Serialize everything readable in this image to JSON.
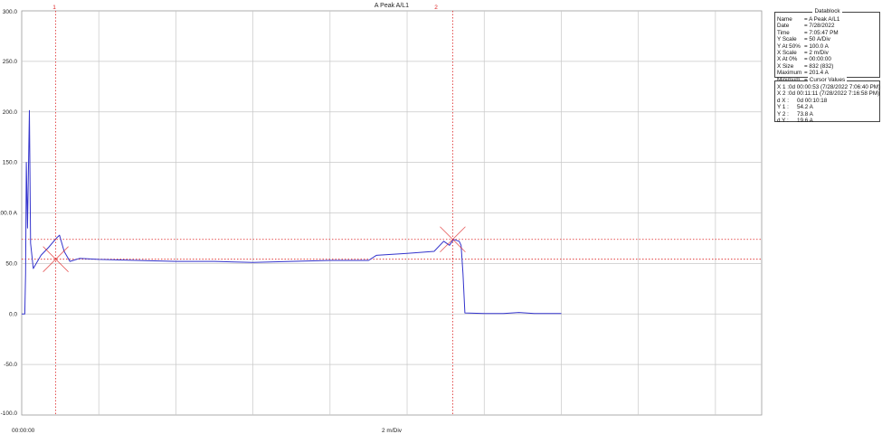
{
  "title": "A Peak A/L1",
  "x_start_label": "00:00:00",
  "x_div_label": "2 m/Div",
  "cursor_markers": {
    "c1": "1",
    "c2": "2"
  },
  "colors": {
    "trace": "#3333cc",
    "cursor": "#dd2222",
    "grid": "#c8c8c8"
  },
  "datablock": {
    "title": "Datablock",
    "rows": [
      {
        "k": "Name",
        "v": "= A Peak A/L1"
      },
      {
        "k": "Date",
        "v": "= 7/28/2022"
      },
      {
        "k": "Time",
        "v": "= 7:05:47 PM"
      },
      {
        "k": "Y Scale",
        "v": "=   50   A/Div"
      },
      {
        "k": "Y At 50%",
        "v": "= 100.0 A"
      },
      {
        "k": "X Scale",
        "v": "=    2   m/Div"
      },
      {
        "k": "X At 0%",
        "v": "= 00:00:00"
      },
      {
        "k": "X Size",
        "v": "= 832 (832)"
      },
      {
        "k": "Maximum",
        "v": "=  201.4 A"
      },
      {
        "k": "Minimum",
        "v": "=    0.2 A"
      }
    ]
  },
  "cursor_values": {
    "title": "Cursor Values",
    "rows": [
      {
        "k": "X 1 :",
        "v": "0d 00:00:53 (7/28/2022 7:06:40 PM)"
      },
      {
        "k": "X 2 :",
        "v": "0d 00:11:11 (7/28/2022 7:16:58 PM)"
      },
      {
        "k": "d X :",
        "v": "0d 00:10:18"
      },
      {
        "k": "Y 1 :",
        "v": "54.2 A"
      },
      {
        "k": "Y 2 :",
        "v": "73.8 A"
      },
      {
        "k": "d Y :",
        "v": "19.6 A"
      }
    ]
  },
  "chart_data": {
    "type": "line",
    "title": "A Peak A/L1",
    "xlabel": "2 m/Div",
    "ylabel": "",
    "x_unit": "minutes",
    "ylim": [
      -100,
      300
    ],
    "xlim": [
      0,
      19.2
    ],
    "y_ticks": [
      -100,
      -50,
      0,
      50,
      100,
      150,
      200,
      250,
      300
    ],
    "y_tick_labels": [
      "-100.0",
      "-50.0",
      "0.0",
      "50.0",
      "100.0 A",
      "150.0",
      "200.0",
      "250.0",
      "300.0"
    ],
    "grid": true,
    "cursors": [
      {
        "label": "1",
        "x": 0.883,
        "y": 54.2
      },
      {
        "label": "2",
        "x": 11.183,
        "y": 73.8
      }
    ],
    "series": [
      {
        "values": [
          [
            0,
            0
          ],
          [
            0.08,
            0
          ],
          [
            0.1,
            40
          ],
          [
            0.12,
            150
          ],
          [
            0.15,
            85
          ],
          [
            0.2,
            201.4
          ],
          [
            0.23,
            70
          ],
          [
            0.3,
            45
          ],
          [
            0.5,
            58
          ],
          [
            0.7,
            66
          ],
          [
            0.9,
            75
          ],
          [
            0.98,
            78
          ],
          [
            1.1,
            62
          ],
          [
            1.25,
            52
          ],
          [
            1.5,
            55
          ],
          [
            2,
            54
          ],
          [
            3,
            53
          ],
          [
            4,
            52
          ],
          [
            5,
            52
          ],
          [
            6,
            51
          ],
          [
            7,
            52
          ],
          [
            8,
            53
          ],
          [
            9,
            53
          ],
          [
            9.2,
            58
          ],
          [
            10,
            60
          ],
          [
            10.7,
            62
          ],
          [
            10.95,
            72
          ],
          [
            11.1,
            68
          ],
          [
            11.2,
            73.8
          ],
          [
            11.35,
            72
          ],
          [
            11.4,
            68
          ],
          [
            11.45,
            40
          ],
          [
            11.5,
            1
          ],
          [
            12,
            0.5
          ],
          [
            12.5,
            0.5
          ],
          [
            12.9,
            1.5
          ],
          [
            13.3,
            0.5
          ],
          [
            14,
            0.5
          ]
        ]
      }
    ]
  }
}
